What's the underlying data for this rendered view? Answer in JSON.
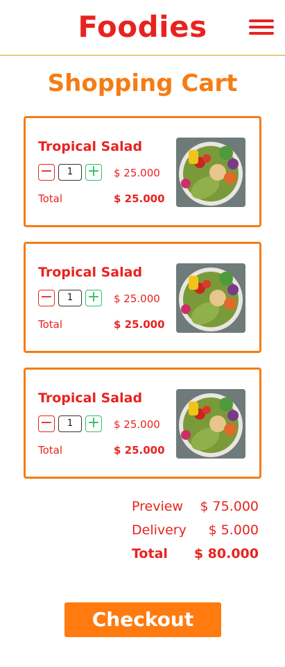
{
  "header": {
    "brand": "Foodies",
    "menu_icon": "hamburger-menu-icon"
  },
  "page_title": "Shopping Cart",
  "cart_items": [
    {
      "name": "Tropical Salad",
      "quantity": "1",
      "unit_price": "$ 25.000",
      "total_label": "Total",
      "total_value": "$ 25.000",
      "image_icon": "salad-bowl-image"
    },
    {
      "name": "Tropical Salad",
      "quantity": "1",
      "unit_price": "$ 25.000",
      "total_label": "Total",
      "total_value": "$ 25.000",
      "image_icon": "salad-bowl-image"
    },
    {
      "name": "Tropical Salad",
      "quantity": "1",
      "unit_price": "$ 25.000",
      "total_label": "Total",
      "total_value": "$ 25.000",
      "image_icon": "salad-bowl-image"
    }
  ],
  "qty_controls": {
    "minus": "−",
    "plus": "+"
  },
  "summary": {
    "preview_label": "Preview",
    "preview_value": "$ 75.000",
    "delivery_label": "Delivery",
    "delivery_value": "$ 5.000",
    "total_label": "Total",
    "total_value": "$ 80.000"
  },
  "checkout_label": "Checkout",
  "colors": {
    "brand_red": "#e8231f",
    "accent_orange": "#f57c14",
    "plus_green": "#2dbf67",
    "button_orange": "#ff7b0f"
  }
}
